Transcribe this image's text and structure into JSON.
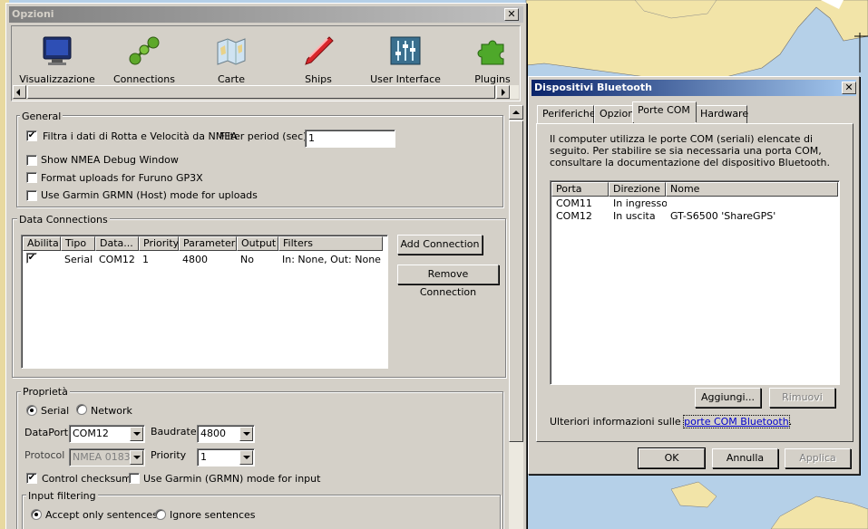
{
  "options": {
    "title": "Opzioni",
    "toolbar": [
      {
        "label": "Visualizzazione",
        "icon": "monitor-icon"
      },
      {
        "label": "Connections",
        "icon": "connections-icon"
      },
      {
        "label": "Carte",
        "icon": "charts-icon"
      },
      {
        "label": "Ships",
        "icon": "ship-icon"
      },
      {
        "label": "User Interface",
        "icon": "sliders-icon"
      },
      {
        "label": "Plugins",
        "icon": "puzzle-icon"
      }
    ],
    "general": {
      "legend": "General",
      "filter_nmea": {
        "label": "Filtra i dati di Rotta e Velocità da NMEA",
        "checked": true
      },
      "filter_period_label": "Filter period (sec)",
      "filter_period_value": "1",
      "show_debug": {
        "label": "Show NMEA Debug Window",
        "checked": false
      },
      "furuno": {
        "label": "Format uploads for Furuno GP3X",
        "checked": false
      },
      "garmin_host": {
        "label": "Use Garmin GRMN (Host) mode for uploads",
        "checked": false
      }
    },
    "data_connections": {
      "legend": "Data Connections",
      "columns": [
        "Abilita",
        "Tipo",
        "Data...",
        "Priority",
        "Parameters",
        "Output",
        "Filters"
      ],
      "rows": [
        {
          "enabled": true,
          "tipo": "Serial",
          "data": "COM12",
          "priority": "1",
          "parameters": "4800",
          "output": "No",
          "filters": "In: None, Out: None"
        }
      ],
      "add_button": "Add Connection",
      "remove_button": "Remove Connection"
    },
    "properties": {
      "legend": "Proprietà",
      "serial_label": "Serial",
      "network_label": "Network",
      "selected_mode": "Serial",
      "dataport_label": "DataPort",
      "dataport_value": "COM12",
      "baudrate_label": "Baudrate",
      "baudrate_value": "4800",
      "protocol_label": "Protocol",
      "protocol_value": "NMEA 0183",
      "priority_label": "Priority",
      "priority_value": "1",
      "checksum": {
        "label": "Control checksum",
        "checked": true
      },
      "garmin_input": {
        "label": "Use Garmin (GRMN) mode for input",
        "checked": false
      },
      "input_filtering": {
        "legend": "Input filtering",
        "accept_label": "Accept only sentences",
        "ignore_label": "Ignore sentences",
        "selected": "accept"
      }
    }
  },
  "bluetooth": {
    "title": "Dispositivi Bluetooth",
    "tabs": [
      "Periferiche",
      "Opzioni",
      "Porte COM",
      "Hardware"
    ],
    "active_tab": "Porte COM",
    "description": "Il computer utilizza le porte COM (seriali) elencate di seguito. Per stabilire se sia necessaria una porta COM, consultare la documentazione del dispositivo Bluetooth.",
    "columns": [
      "Porta",
      "Direzione",
      "Nome"
    ],
    "rows": [
      {
        "porta": "COM11",
        "direzione": "In ingresso",
        "nome": ""
      },
      {
        "porta": "COM12",
        "direzione": "In uscita",
        "nome": "GT-S6500 'ShareGPS'"
      }
    ],
    "add_button": "Aggiungi...",
    "remove_button": "Rimuovi",
    "more_info_prefix": "Ulteriori informazioni sulle ",
    "more_info_link": "porte COM Bluetooth",
    "more_info_suffix": ".",
    "ok_button": "OK",
    "cancel_button": "Annulla",
    "apply_button": "Applica"
  },
  "colors": {
    "title_active": "#0a246a",
    "title_inactive": "#808080",
    "dialog_face": "#d4d0c8",
    "map_land": "#f2e4a8",
    "map_water": "#b5d0e8"
  }
}
